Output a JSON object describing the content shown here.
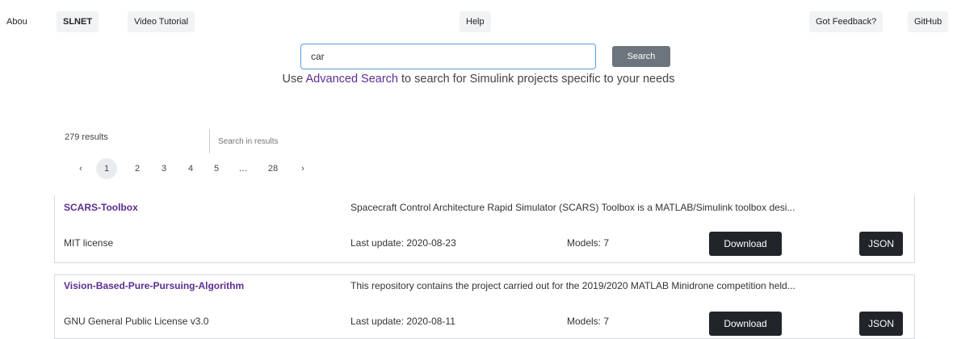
{
  "nav": {
    "about": "Abou",
    "brand": "SLNET",
    "video": "Video Tutorial",
    "help": "Help",
    "feedback": "Got Feedback?",
    "github": "GitHub"
  },
  "search": {
    "value": "car",
    "button": "Search"
  },
  "advanced": {
    "prefix": "Use ",
    "link": "Advanced Search",
    "suffix": " to search for Simulink projects specific to your needs"
  },
  "results": {
    "count": "279 results",
    "search_in_placeholder": "Search in results"
  },
  "pagination": {
    "prev": "‹",
    "current": "1",
    "pages": [
      "2",
      "3",
      "4",
      "5",
      "…",
      "28"
    ],
    "next": "›"
  },
  "projects": [
    {
      "title": "SCARS-Toolbox",
      "description": "Spacecraft Control Architecture Rapid Simulator (SCARS) Toolbox is a MATLAB/Simulink toolbox desi...",
      "license": "MIT license",
      "updated": "Last update: 2020-08-23",
      "models": "Models: 7",
      "download": "Download",
      "json": "JSON"
    },
    {
      "title": "Vision-Based-Pure-Pursuing-Algorithm",
      "description": "This repository contains the project carried out for the 2019/2020 MATLAB Minidrone competition held...",
      "license": "GNU General Public License v3.0",
      "updated": "Last update: 2020-08-11",
      "models": "Models: 7",
      "download": "Download",
      "json": "JSON"
    }
  ]
}
